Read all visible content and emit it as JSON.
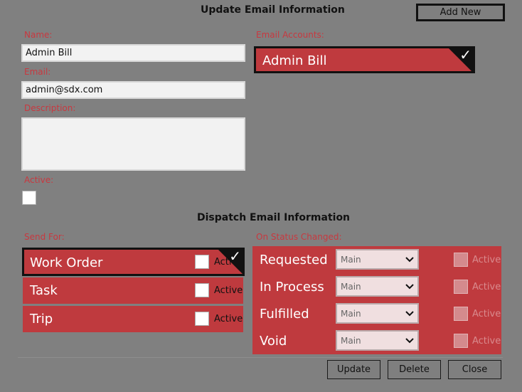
{
  "header": {
    "title": "Update Email Information",
    "add_new_label": "Add New"
  },
  "form": {
    "name_label": "Name:",
    "name_value": "Admin Bill",
    "email_label": "Email:",
    "email_value": "admin@sdx.com",
    "description_label": "Description:",
    "description_value": "",
    "active_label": "Active:"
  },
  "accounts": {
    "label": "Email Accounts:",
    "items": [
      {
        "label": "Admin Bill",
        "selected": true
      }
    ]
  },
  "dispatch": {
    "title": "Dispatch Email Information",
    "send_for_label": "Send For:",
    "send_for": [
      {
        "label": "Work Order",
        "active_label": "Active",
        "selected": true
      },
      {
        "label": "Task",
        "active_label": "Active",
        "selected": false
      },
      {
        "label": "Trip",
        "active_label": "Active",
        "selected": false
      }
    ],
    "status_label": "On Status Changed:",
    "statuses": [
      {
        "label": "Requested",
        "select_value": "Main",
        "active_label": "Active"
      },
      {
        "label": "In Process",
        "select_value": "Main",
        "active_label": "Active"
      },
      {
        "label": "Fulfilled",
        "select_value": "Main",
        "active_label": "Active"
      },
      {
        "label": "Void",
        "select_value": "Main",
        "active_label": "Active"
      }
    ]
  },
  "footer": {
    "update_label": "Update",
    "delete_label": "Delete",
    "close_label": "Close"
  },
  "colors": {
    "background": "#808080",
    "accent_red": "#bf3a3e",
    "label_red": "#c8383f"
  }
}
